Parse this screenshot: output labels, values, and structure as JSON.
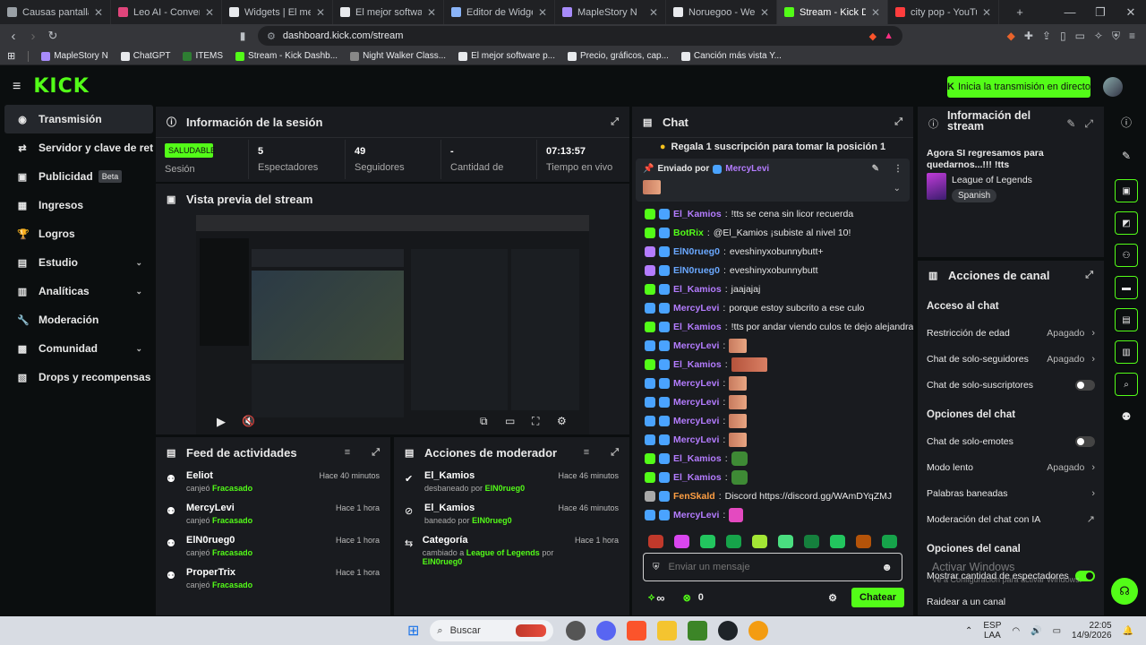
{
  "browser": {
    "tabs": [
      {
        "label": "Causas pantalla azul",
        "color": "#9aa0a6"
      },
      {
        "label": "Leo AI - Conversations A",
        "color": "#e0457b"
      },
      {
        "label": "Widgets | El mejor softwa",
        "color": "#e8eaed"
      },
      {
        "label": "El mejor software para po",
        "color": "#e8eaed"
      },
      {
        "label": "Editor de Widget — Dash",
        "color": "#8ab4f8"
      },
      {
        "label": "MapleStory N",
        "color": "#a78bfa"
      },
      {
        "label": "Noruegoo - Weretige",
        "color": "#e8eaed"
      },
      {
        "label": "Stream - Kick Dashbo",
        "color": "#53fc18",
        "active": true
      },
      {
        "label": "city pop - YouTube",
        "color": "#ff3d3d"
      }
    ],
    "new_tab": "+",
    "url": "dashboard.kick.com/stream",
    "bookmarks": [
      {
        "label": "MapleStory N",
        "color": "#a78bfa"
      },
      {
        "label": "ChatGPT",
        "color": "#e8eaed"
      },
      {
        "label": "ITEMS",
        "color": "#2e7d32"
      },
      {
        "label": "Stream - Kick Dashb...",
        "color": "#53fc18"
      },
      {
        "label": "Night Walker Class...",
        "color": "#888"
      },
      {
        "label": "El mejor software p...",
        "color": "#e8eaed"
      },
      {
        "label": "Precio, gráficos, cap...",
        "color": "#e8eaed"
      },
      {
        "label": "Canción más vista Y...",
        "color": "#e8eaed"
      }
    ]
  },
  "header": {
    "logo": "KICK",
    "go_live": "Inicia la transmisión en directo"
  },
  "sidebar": {
    "items": [
      {
        "label": "Transmisión",
        "icon": "◉"
      },
      {
        "label": "Servidor y clave de retrans",
        "icon": "⇄"
      },
      {
        "label": "Publicidad",
        "icon": "▣",
        "badge": "Beta"
      },
      {
        "label": "Ingresos",
        "icon": "▦"
      },
      {
        "label": "Logros",
        "icon": "🏆"
      },
      {
        "label": "Estudio",
        "icon": "▤",
        "chevron": "⌄"
      },
      {
        "label": "Analíticas",
        "icon": "▥",
        "chevron": "⌄"
      },
      {
        "label": "Moderación",
        "icon": "🔧"
      },
      {
        "label": "Comunidad",
        "icon": "▩",
        "chevron": "⌄"
      },
      {
        "label": "Drops y recompensas",
        "icon": "▧"
      }
    ]
  },
  "session": {
    "title": "Información de la sesión",
    "status_badge": "SALUDABLE",
    "status_label": "Sesión",
    "viewers": "5",
    "viewers_label": "Espectadores",
    "followers": "49",
    "followers_label": "Seguidores",
    "subs": "-",
    "subs_label": "Cantidad de",
    "uptime": "07:13:57",
    "uptime_label": "Tiempo en vivo"
  },
  "preview": {
    "title": "Vista previa del stream"
  },
  "feed": {
    "title": "Feed de actividades",
    "items": [
      {
        "name": "Eeliot",
        "action": "canjeó",
        "reward": "Fracasado",
        "time": "Hace 40 minutos"
      },
      {
        "name": "MercyLevi",
        "action": "canjeó",
        "reward": "Fracasado",
        "time": "Hace 1 hora"
      },
      {
        "name": "ElN0rueg0",
        "action": "canjeó",
        "reward": "Fracasado",
        "time": "Hace 1 hora"
      },
      {
        "name": "ProperTrix",
        "action": "canjeó",
        "reward": "Fracasado",
        "time": "Hace 1 hora"
      }
    ]
  },
  "mod": {
    "title": "Acciones de moderador",
    "items": [
      {
        "name": "El_Kamios",
        "detail_pre": "desbaneado por",
        "by": "ElN0rueg0",
        "detail_mid": "",
        "time": "Hace 46 minutos"
      },
      {
        "name": "El_Kamios",
        "detail_pre": "baneado por",
        "by": "ElN0rueg0",
        "detail_mid": "",
        "time": "Hace 46 minutos"
      },
      {
        "name": "Categoría",
        "detail_pre": "cambiado a",
        "by": "League of Legends",
        "detail_mid": "por",
        "by2": "ElN0rueg0",
        "time": "Hace 1 hora"
      }
    ]
  },
  "chat": {
    "title": "Chat",
    "gift_banner": "Regala 1 suscripción para tomar la posición 1",
    "pinned_prefix": "Enviado por",
    "pinned_user": "MercyLevi",
    "messages": [
      {
        "user": "El_Kamios",
        "color": "#b47cff",
        "text": "!tts se cena sin licor recuerda",
        "badge": "#53fc18"
      },
      {
        "user": "BotRix",
        "color": "#53fc18",
        "text": "@El_Kamios ¡subiste al nivel 10!",
        "badge": "#53fc18"
      },
      {
        "user": "ElN0rueg0",
        "color": "#6aa8ff",
        "text": "eveshinyxobunnybutt+",
        "badge": "#b47cff"
      },
      {
        "user": "ElN0rueg0",
        "color": "#6aa8ff",
        "text": "eveshinyxobunnybutt",
        "badge": "#b47cff"
      },
      {
        "user": "El_Kamios",
        "color": "#b47cff",
        "text": "jaajajaj",
        "badge": "#53fc18"
      },
      {
        "user": "MercyLevi",
        "color": "#b47cff",
        "text": "porque estoy subcrito a ese culo",
        "badge": "#4aa3ff"
      },
      {
        "user": "El_Kamios",
        "color": "#b47cff",
        "text": "!tts por andar viendo culos te dejo alejandra",
        "badge": "#53fc18"
      },
      {
        "user": "MercyLevi",
        "color": "#b47cff",
        "text": "",
        "emote": "b",
        "badge": "#4aa3ff"
      },
      {
        "user": "El_Kamios",
        "color": "#b47cff",
        "text": "",
        "emote": "wide",
        "badge": "#53fc18"
      },
      {
        "user": "MercyLevi",
        "color": "#b47cff",
        "text": "",
        "emote": "b",
        "badge": "#4aa3ff"
      },
      {
        "user": "MercyLevi",
        "color": "#b47cff",
        "text": "",
        "emote": "b",
        "badge": "#4aa3ff"
      },
      {
        "user": "MercyLevi",
        "color": "#b47cff",
        "text": "",
        "emote": "b",
        "badge": "#4aa3ff"
      },
      {
        "user": "MercyLevi",
        "color": "#b47cff",
        "text": "",
        "emote": "b",
        "badge": "#4aa3ff"
      },
      {
        "user": "El_Kamios",
        "color": "#b47cff",
        "text": "",
        "emote": "g",
        "badge": "#53fc18"
      },
      {
        "user": "El_Kamios",
        "color": "#b47cff",
        "text": "",
        "emote": "g",
        "badge": "#53fc18"
      },
      {
        "user": "FenSkald",
        "color": "#ff9f43",
        "text": "Discord https://discord.gg/WAmDYqZMJ",
        "badge": "#aaa"
      },
      {
        "user": "MercyLevi",
        "color": "#b47cff",
        "text": "",
        "emote": "p",
        "badge": "#4aa3ff"
      }
    ],
    "input_placeholder": "Enviar un mensaje",
    "infinity": "∞",
    "points": "0",
    "send": "Chatear"
  },
  "stream_info": {
    "title": "Información del stream",
    "stream_title": "Agora SI regresamos para quedarnos...!!! !tts",
    "category": "League of Legends",
    "language": "Spanish"
  },
  "channel": {
    "title": "Acciones de canal",
    "chat_access": "Acceso al chat",
    "age": "Restricción de edad",
    "age_val": "Apagado",
    "followers_only": "Chat de solo-seguidores",
    "followers_only_val": "Apagado",
    "subs_only": "Chat de solo-suscriptores",
    "chat_options": "Opciones del chat",
    "emotes_only": "Chat de solo-emotes",
    "slow": "Modo lento",
    "slow_val": "Apagado",
    "banned_words": "Palabras baneadas",
    "ai_mod": "Moderación del chat con IA",
    "channel_options": "Opciones del canal",
    "show_viewers": "Mostrar cantidad de espectadores",
    "raid": "Raidear a un canal",
    "watermark1": "Activar Windows",
    "watermark2": "Ve a Configuración para activar Windows."
  },
  "taskbar": {
    "search": "Buscar",
    "lang1": "ESP",
    "lang2": "LAA",
    "time": "22:05",
    "date": "14/9/2026"
  }
}
